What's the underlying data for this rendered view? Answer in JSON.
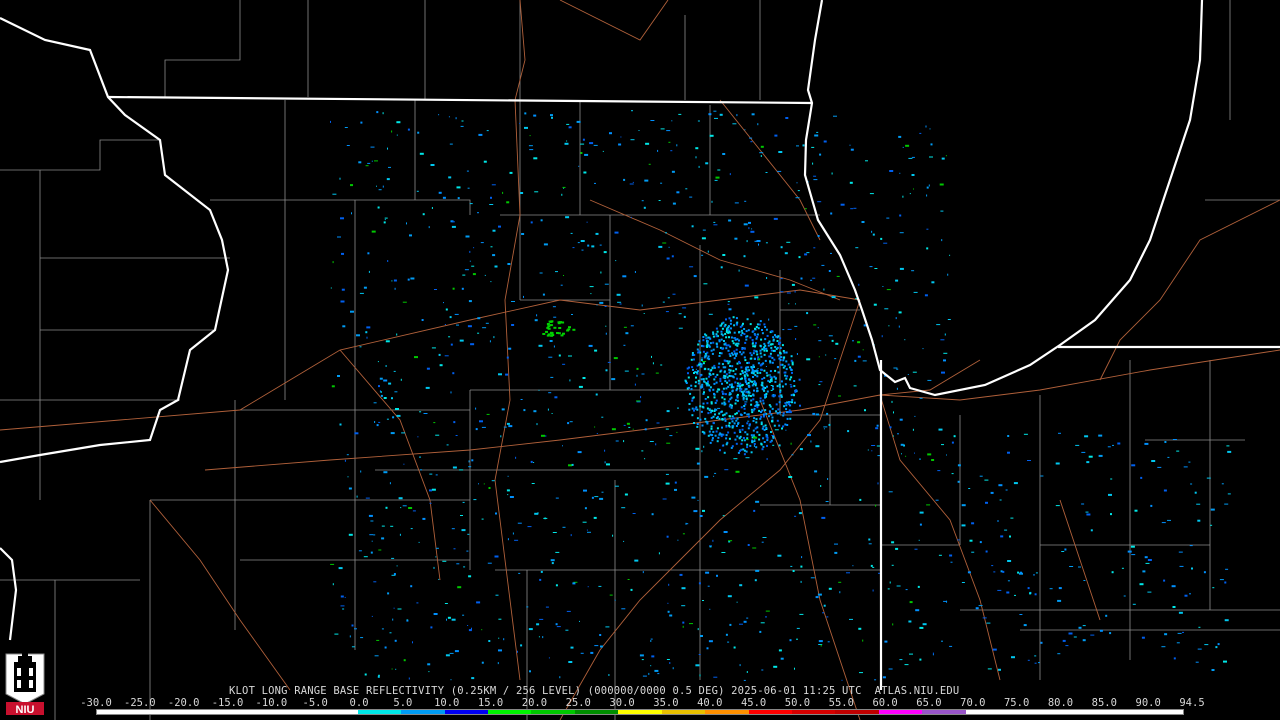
{
  "map": {
    "product_caption": "KLOT LONG RANGE BASE REFLECTIVITY (0.25KM / 256 LEVEL) (000000/0000 0.5 DEG) 2025-06-01 11:25 UTC  ATLAS.NIU.EDU",
    "background_color": "#000000",
    "state_border_color": "#ffffff",
    "county_line_color": "#8c8c8c",
    "highway_color": "#b0603a"
  },
  "color_scale": {
    "labels": [
      "-30.0",
      "-25.0",
      "-20.0",
      "-15.0",
      "-10.0",
      "-5.0",
      "0.0",
      "5.0",
      "10.0",
      "15.0",
      "20.0",
      "25.0",
      "30.0",
      "35.0",
      "40.0",
      "45.0",
      "50.0",
      "55.0",
      "60.0",
      "65.0",
      "70.0",
      "75.0",
      "80.0",
      "85.0",
      "90.0",
      "94.5"
    ],
    "colors": [
      "#ffffff",
      "#ffffff",
      "#ffffff",
      "#ffffff",
      "#ffffff",
      "#ffffff",
      "#00e8e8",
      "#009cf4",
      "#0000f4",
      "#00f400",
      "#00c800",
      "#008e00",
      "#ffff00",
      "#e8c000",
      "#ff9000",
      "#ff0000",
      "#d60000",
      "#c00000",
      "#ff00ff",
      "#9955c9",
      "#ffffff",
      "#ffffff",
      "#ffffff",
      "#ffffff",
      "#ffffff"
    ]
  },
  "logo": {
    "text": "NIU",
    "icon": "niu-tower-icon",
    "color": "#c8102e"
  }
}
